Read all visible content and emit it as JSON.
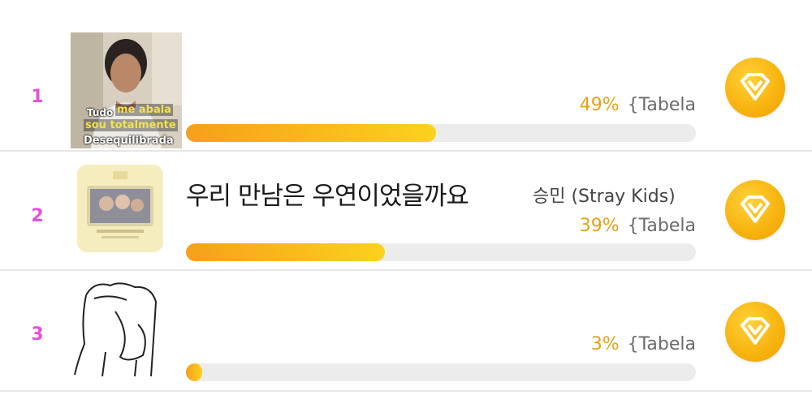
{
  "accent_colors": {
    "rank": "#e352d9",
    "percent": "#e3a416",
    "bar_start": "#f6a01a",
    "bar_end": "#fbd21c",
    "vote": "#f7b20d"
  },
  "rows": [
    {
      "rank": "1",
      "thumb": {
        "caption_top": "Tudo",
        "caption_mid1": "me abala",
        "caption_mid2": "sou totalmente",
        "caption_bottom": "Desequilibrada"
      },
      "title": "",
      "artist": "",
      "percent_label": "49%",
      "tag": "{Tabela",
      "percent_value": 49,
      "vote_icon": "heart-diamond-icon"
    },
    {
      "rank": "2",
      "title": "우리 만남은 우연이었을까요",
      "artist": "승민  (Stray Kids)",
      "percent_label": "39%",
      "tag": "{Tabela",
      "percent_value": 39,
      "vote_icon": "heart-diamond-icon"
    },
    {
      "rank": "3",
      "title": "",
      "artist": "",
      "percent_label": "3%",
      "tag": "{Tabela",
      "percent_value": 3,
      "vote_icon": "heart-diamond-icon"
    }
  ]
}
